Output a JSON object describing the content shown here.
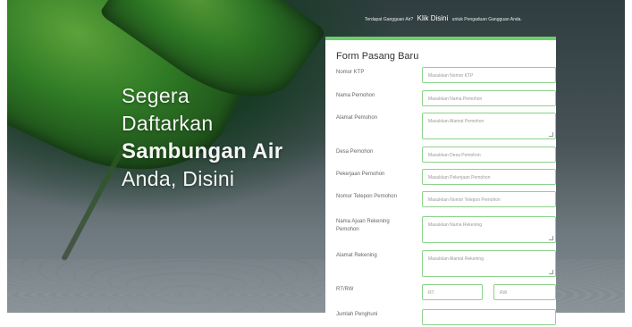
{
  "top_note": {
    "before": "Terdapat Gangguan Air?",
    "link": "Klik Disini",
    "after": "untuk Pengaduan Gangguan Anda."
  },
  "hero": {
    "line1": "Segera",
    "line2": "Daftarkan",
    "line3": "Sambungan Air",
    "line4": "Anda, Disini"
  },
  "form": {
    "title": "Form Pasang Baru",
    "fields": [
      {
        "label": "Nomor KTP",
        "placeholder": "Masukkan Nomor KTP"
      },
      {
        "label": "Nama Pemohon",
        "placeholder": "Masukkan Nama Pemohon"
      },
      {
        "label": "Alamat Pemohon",
        "placeholder": "Masukkan Alamat Pemohon"
      },
      {
        "label": "Desa Pemohon",
        "placeholder": "Masukkan Desa Pemohon"
      },
      {
        "label": "Pekerjaan Pemohon",
        "placeholder": "Masukkan Pekerjaan Pemohon"
      },
      {
        "label": "Nomor Telepon Pemohon",
        "placeholder": "Masukkan Nomor Telepon Pemohon"
      },
      {
        "label": "Nama Ajuan Rekening Pemohon",
        "placeholder": "Masukkan Nama Rekening"
      },
      {
        "label": "Alamat Rekening",
        "placeholder": "Masukkan Alamat Rekening"
      },
      {
        "label": "RT/RW",
        "placeholder_rt": "RT",
        "placeholder_rw": "RW"
      },
      {
        "label": "Jumlah Penghuni"
      }
    ]
  }
}
